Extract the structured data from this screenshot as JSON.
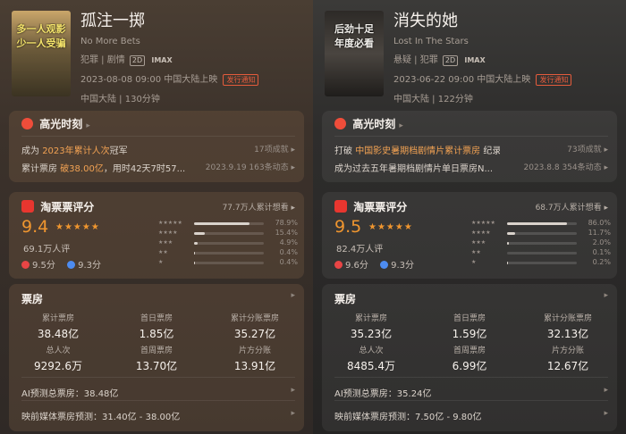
{
  "left": {
    "poster": {
      "line1": "多一人观影",
      "line2": "少一人受骗"
    },
    "title": "孤注一掷",
    "en_title": "No More Bets",
    "genres": "犯罪 | 剧情",
    "format_tag1": "2D",
    "format_tag2": "IMAX",
    "release": "2023-08-08 09:00 中国大陆上映",
    "notice": "发行通知",
    "region_duration": "中国大陆 | 130分钟",
    "highlight": {
      "title": "高光时刻",
      "row1_prefix": "成为",
      "row1_accent": "2023年累计人次",
      "row1_suffix": "冠军",
      "row1_right": "17项成就 ▸",
      "row2_prefix": "累计票房",
      "row2_accent": "破38.00亿",
      "row2_suffix": "，用时42天7时57...",
      "row2_right": "2023.9.19 163条动态 ▸"
    },
    "rating": {
      "title": "淘票票评分",
      "want": "77.7万人累计想看 ▸",
      "score": "9.4",
      "stars": "★★★★★",
      "count": "69.1万人评",
      "sub1": "9.5分",
      "sub2": "9.3分",
      "dist": [
        {
          "stars": "★★★★★",
          "pct": "78.9%",
          "value": 78.9
        },
        {
          "stars": "★★★★",
          "pct": "15.4%",
          "value": 15.4
        },
        {
          "stars": "★★★",
          "pct": "4.9%",
          "value": 4.9
        },
        {
          "stars": "★★",
          "pct": "0.4%",
          "value": 0.4
        },
        {
          "stars": "★",
          "pct": "0.4%",
          "value": 0.4
        }
      ]
    },
    "box": {
      "title": "票房",
      "stats": [
        {
          "label": "累计票房",
          "value": "38.48亿"
        },
        {
          "label": "首日票房",
          "value": "1.85亿"
        },
        {
          "label": "累计分账票房",
          "value": "35.27亿"
        },
        {
          "label": "总人次",
          "value": "9292.6万"
        },
        {
          "label": "首周票房",
          "value": "13.70亿"
        },
        {
          "label": "片方分账",
          "value": "13.91亿"
        }
      ],
      "ai": "AI预测总票房：38.48亿",
      "media": "映前媒体票房预测：31.40亿 - 38.00亿"
    }
  },
  "right": {
    "poster": {
      "line1": "后劲十足",
      "line2": "年度必看"
    },
    "title": "消失的她",
    "en_title": "Lost In The Stars",
    "genres": "悬疑 | 犯罪",
    "format_tag1": "2D",
    "format_tag2": "IMAX",
    "release": "2023-06-22 09:00 中国大陆上映",
    "notice": "发行通知",
    "region_duration": "中国大陆 | 122分钟",
    "highlight": {
      "title": "高光时刻",
      "row1_prefix": "打破",
      "row1_accent": "中国影史暑期档剧情片累计票房",
      "row1_suffix": "纪录",
      "row1_right": "73项成就 ▸",
      "row2_prefix": "成为过去五年暑期档剧情片单日票房N...",
      "row2_accent": "",
      "row2_suffix": "",
      "row2_right": "2023.8.8 354条动态 ▸"
    },
    "rating": {
      "title": "淘票票评分",
      "want": "68.7万人累计想看 ▸",
      "score": "9.5",
      "stars": "★★★★★",
      "count": "82.4万人评",
      "sub1": "9.6分",
      "sub2": "9.3分",
      "dist": [
        {
          "stars": "★★★★★",
          "pct": "86.0%",
          "value": 86.0
        },
        {
          "stars": "★★★★",
          "pct": "11.7%",
          "value": 11.7
        },
        {
          "stars": "★★★",
          "pct": "2.0%",
          "value": 2.0
        },
        {
          "stars": "★★",
          "pct": "0.1%",
          "value": 0.1
        },
        {
          "stars": "★",
          "pct": "0.2%",
          "value": 0.2
        }
      ]
    },
    "box": {
      "title": "票房",
      "stats": [
        {
          "label": "累计票房",
          "value": "35.23亿"
        },
        {
          "label": "首日票房",
          "value": "1.59亿"
        },
        {
          "label": "累计分账票房",
          "value": "32.13亿"
        },
        {
          "label": "总人次",
          "value": "8485.4万"
        },
        {
          "label": "首周票房",
          "value": "6.99亿"
        },
        {
          "label": "片方分账",
          "value": "12.67亿"
        }
      ],
      "ai": "AI预测总票房：35.24亿",
      "media": "映前媒体票房预测：7.50亿 - 9.80亿"
    }
  },
  "colors": {
    "accent": "#f0962f",
    "highlight_text": "#f2a253",
    "notice": "#e45b3c",
    "taopiaopiao_red": "#e8362f"
  },
  "chevron": "▸"
}
